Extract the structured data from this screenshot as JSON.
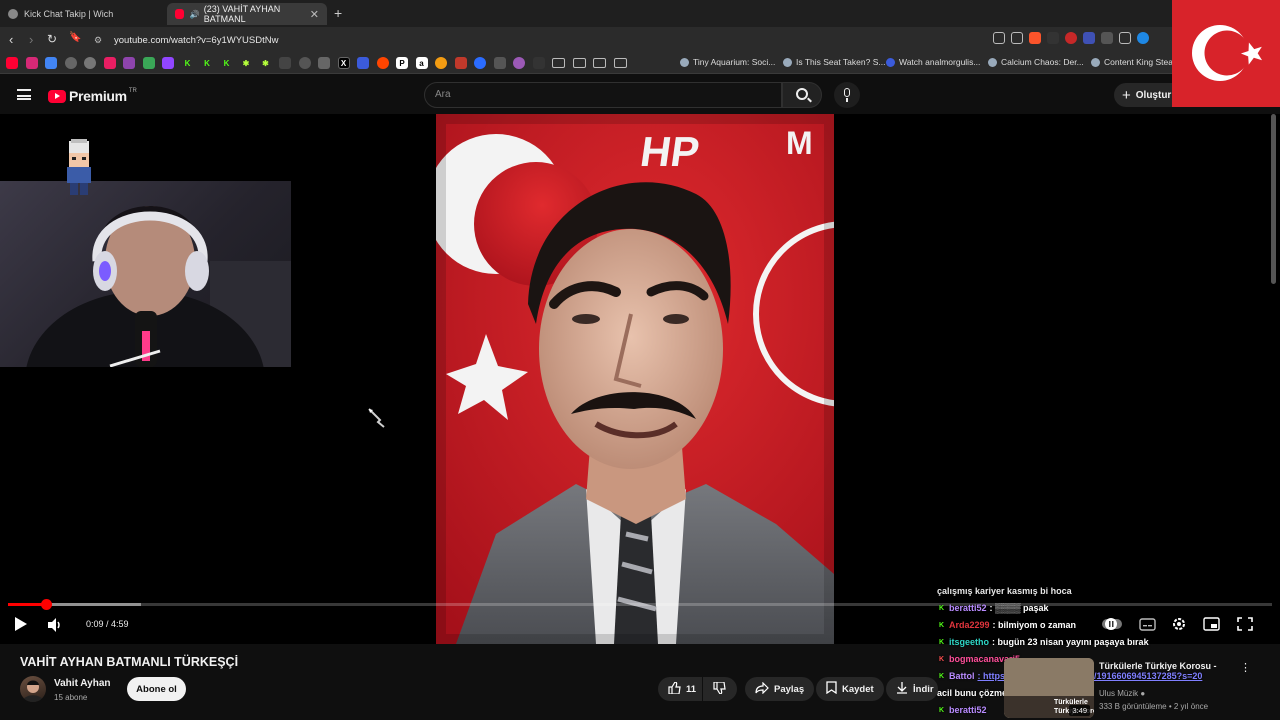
{
  "browser": {
    "tabs": [
      {
        "title": "Kick Chat Takip | Wich"
      },
      {
        "title": "(23) VAHİT AYHAN BATMANL",
        "audio_icon": "speaker-icon"
      }
    ],
    "url": "youtube.com/watch?v=6y1WYUSDtNw",
    "bookmarks": [
      {
        "label": "Tiny Aquarium: Soci..."
      },
      {
        "label": "Is This Seat Taken? S..."
      },
      {
        "label": "Watch analmorgulis..."
      },
      {
        "label": "Calcium Chaos: Der..."
      },
      {
        "label": "Content King Steam"
      }
    ]
  },
  "youtube": {
    "logo_text": "Premium",
    "logo_region": "TR",
    "search_placeholder": "Ara",
    "create_label": "Oluştur"
  },
  "player": {
    "current_time": "0:09 / 4:59",
    "progress_fraction": 0.03,
    "buffer_fraction": 0.105
  },
  "chat": [
    {
      "user": "",
      "color": "#e6e6e6",
      "text": "çalışmış kariyer kasmış bi hoca"
    },
    {
      "user": "beratti52",
      "color": "#b98cff",
      "text": ": ▒▒▒▒ paşak"
    },
    {
      "user": "Arda2299",
      "color": "#e0353d",
      "text": ": bilmiyom o zaman"
    },
    {
      "user": "itsgeetho",
      "color": "#2fd7c7",
      "text": ": bugün 23 nisan yayını paşaya bırak"
    },
    {
      "user": "bogmacanavari5",
      "color": "#ff4f9a",
      "text": ""
    },
    {
      "user": "Battol",
      "color": "#b98cff",
      "text": ": https://x.com/hwnb/status/1916606945137285?s=20"
    },
    {
      "user": "",
      "color": "#e6e6e6",
      "text": "acil bunu çözmen lazım"
    },
    {
      "user": "beratti52",
      "color": "#b98cff",
      "text": ""
    }
  ],
  "video_info": {
    "title": "VAHİT AYHAN BATMANLI TÜRKEŞÇİ",
    "channel": "Vahit Ayhan",
    "subscribers": "15 abone",
    "subscribe_label": "Abone ol",
    "likes": "11",
    "share_label": "Paylaş",
    "save_label": "Kaydet",
    "download_label": "İndir"
  },
  "related": {
    "title": "Türkülerle Türkiye Korosu -",
    "channel": "Ulus Müzik",
    "meta": "333 B görüntüleme • 2 yıl önce",
    "duration": "3:49"
  },
  "colors": {
    "accent": "#ff0033",
    "flag_red": "#d8232a",
    "kick_green": "#53fc18"
  }
}
